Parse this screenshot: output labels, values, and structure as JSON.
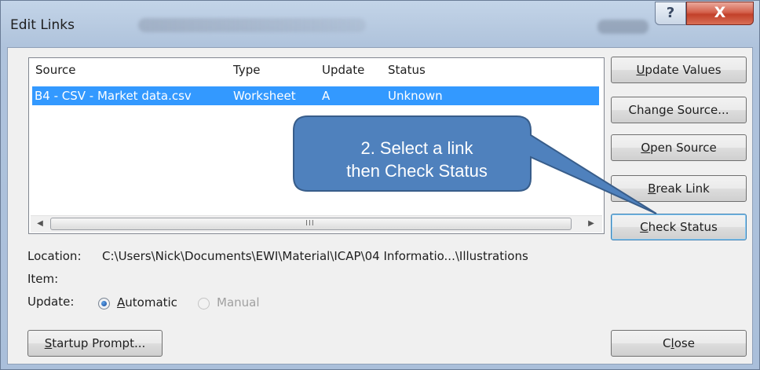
{
  "window": {
    "title": "Edit Links",
    "blurred_caption": "",
    "help_glyph": "?",
    "close_glyph": "X"
  },
  "links_list": {
    "columns": [
      "Source",
      "Type",
      "Update",
      "Status"
    ],
    "rows": [
      {
        "source": "B4 - CSV - Market data.csv",
        "type": "Worksheet",
        "update": "A",
        "status": "Unknown",
        "selected": true
      }
    ],
    "scrollbar_grip": "III"
  },
  "buttons": {
    "update_values": {
      "pre": "",
      "key": "U",
      "post": "pdate Values"
    },
    "change_source": {
      "pre": "Chan",
      "key": "g",
      "post": "e Source..."
    },
    "open_source": {
      "pre": "",
      "key": "O",
      "post": "pen Source"
    },
    "break_link": {
      "pre": "",
      "key": "B",
      "post": "reak Link"
    },
    "check_status": {
      "pre": "",
      "key": "C",
      "post": "heck Status"
    },
    "startup_prompt": {
      "pre": "",
      "key": "S",
      "post": "tartup Prompt..."
    },
    "close": {
      "pre": "C",
      "key": "l",
      "post": "ose"
    }
  },
  "details": {
    "location_label": "Location:",
    "location_value": "C:\\Users\\Nick\\Documents\\EWI\\Material\\ICAP\\04 Informatio...\\Illustrations",
    "item_label": "Item:",
    "item_value": "",
    "update_label": "Update:",
    "automatic": {
      "pre": "",
      "key": "A",
      "post": "utomatic",
      "checked": true
    },
    "manual": {
      "label": "Manual",
      "disabled": true
    }
  },
  "callout": {
    "line1": "2. Select a link",
    "line2": "then Check Status",
    "fill_color": "#4f81bd",
    "border_color": "#385d8a"
  },
  "colors": {
    "selection": "#3399ff",
    "close_button": "#c9442d",
    "dialog_background": "#f0f0f0",
    "frame": "#b5c8df"
  }
}
